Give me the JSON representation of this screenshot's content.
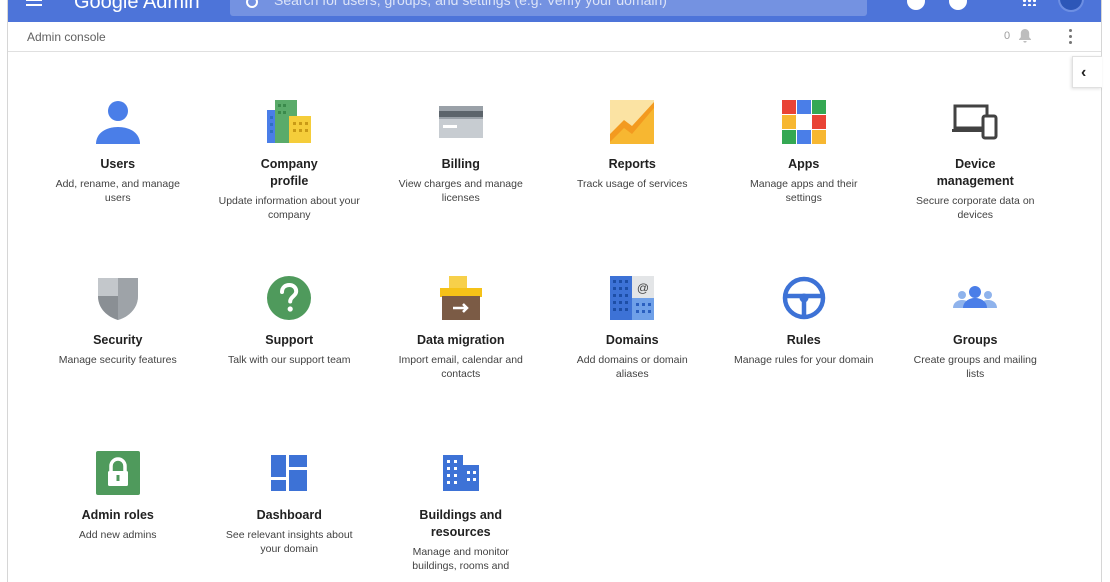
{
  "topbar": {
    "brand": "Google Admin",
    "search_placeholder": "Search for users, groups, and settings (e.g. Verify your domain)"
  },
  "subheader": {
    "title": "Admin console",
    "notification_count": "0"
  },
  "tiles": [
    {
      "title": "Users",
      "desc": "Add, rename, and manage users",
      "icon": "user-icon"
    },
    {
      "title": "Company profile",
      "desc": "Update information about your company",
      "icon": "company-building-icon"
    },
    {
      "title": "Billing",
      "desc": "View charges and manage licenses",
      "icon": "credit-card-icon"
    },
    {
      "title": "Reports",
      "desc": "Track usage of services",
      "icon": "reports-chart-icon"
    },
    {
      "title": "Apps",
      "desc": "Manage apps and their settings",
      "icon": "apps-grid-icon"
    },
    {
      "title": "Device management",
      "desc": "Secure corporate data on devices",
      "icon": "devices-icon"
    },
    {
      "title": "Security",
      "desc": "Manage security features",
      "icon": "shield-icon"
    },
    {
      "title": "Support",
      "desc": "Talk with our support team",
      "icon": "help-question-icon"
    },
    {
      "title": "Data migration",
      "desc": "Import email, calendar and contacts",
      "icon": "migration-box-icon"
    },
    {
      "title": "Domains",
      "desc": "Add domains or domain aliases",
      "icon": "domains-building-icon"
    },
    {
      "title": "Rules",
      "desc": "Manage rules for your domain",
      "icon": "steering-wheel-icon"
    },
    {
      "title": "Groups",
      "desc": "Create groups and mailing lists",
      "icon": "groups-people-icon"
    },
    {
      "title": "Admin roles",
      "desc": "Add new admins",
      "icon": "lock-icon"
    },
    {
      "title": "Dashboard",
      "desc": "See relevant insights about your domain",
      "icon": "dashboard-tiles-icon"
    },
    {
      "title": "Buildings and resources",
      "desc": "Manage and monitor buildings, rooms and",
      "icon": "buildings-icon"
    }
  ]
}
